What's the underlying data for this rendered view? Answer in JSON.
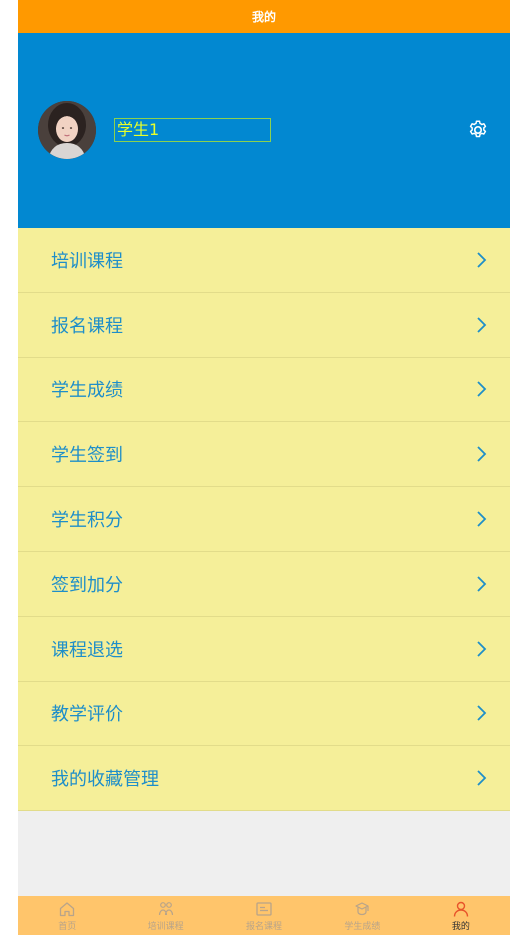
{
  "header": {
    "title": "我的"
  },
  "profile": {
    "username": "学生1"
  },
  "menu": {
    "items": [
      {
        "label": "培训课程"
      },
      {
        "label": "报名课程"
      },
      {
        "label": "学生成绩"
      },
      {
        "label": "学生签到"
      },
      {
        "label": "学生积分"
      },
      {
        "label": "签到加分"
      },
      {
        "label": "课程退选"
      },
      {
        "label": "教学评价"
      },
      {
        "label": "我的收藏管理"
      }
    ]
  },
  "tabbar": {
    "items": [
      {
        "label": "首页",
        "icon": "home-icon"
      },
      {
        "label": "培训课程",
        "icon": "training-icon"
      },
      {
        "label": "报名课程",
        "icon": "register-icon"
      },
      {
        "label": "学生成绩",
        "icon": "grades-icon"
      },
      {
        "label": "我的",
        "icon": "user-icon",
        "active": true
      }
    ]
  },
  "colors": {
    "header_bg": "#ff9900",
    "profile_bg": "#0288d1",
    "menu_bg": "#f5ef99",
    "menu_text": "#1e8ec9",
    "tabbar_bg": "#ffc56b",
    "active_icon": "#e8532a"
  }
}
